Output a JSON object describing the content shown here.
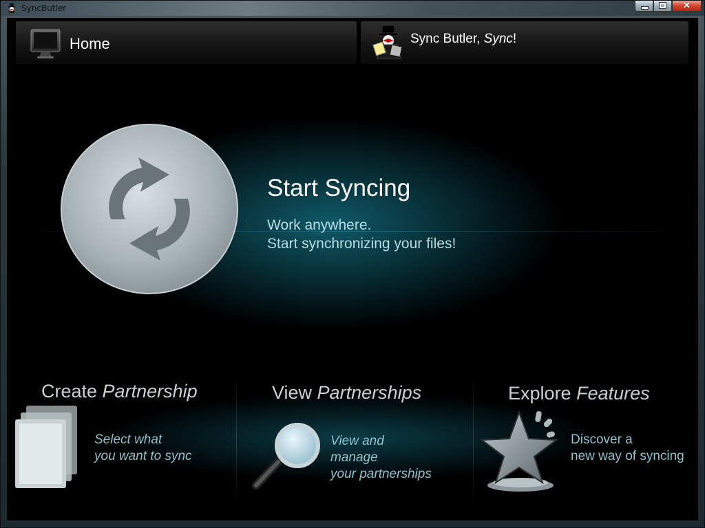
{
  "window": {
    "title": "SyncButler"
  },
  "nav": {
    "home_label": "Home",
    "sync_prefix": "Sync Butler, ",
    "sync_word": "Sync",
    "sync_suffix": "!"
  },
  "hero": {
    "title": "Start Syncing",
    "line1": "Work anywhere.",
    "line2": "Start synchronizing your files!"
  },
  "tiles": [
    {
      "title_plain": "Create ",
      "title_italic": "Partnership",
      "desc": [
        "Select what",
        "you want to sync"
      ],
      "icon": "folders-icon"
    },
    {
      "title_plain": "View ",
      "title_italic": "Partnerships",
      "desc": [
        "View and",
        "manage",
        "your partnerships"
      ],
      "icon": "magnifier-icon"
    },
    {
      "title_plain": "Explore ",
      "title_italic": "Features",
      "desc": [
        "Discover a",
        "new way of syncing"
      ],
      "icon": "star-icon"
    }
  ],
  "colors": {
    "accent_glow": "#14788c",
    "hero_subtext": "#b7dde3",
    "tile_desc": "#8fc1cc",
    "tile_title": "#c8d0d3"
  }
}
